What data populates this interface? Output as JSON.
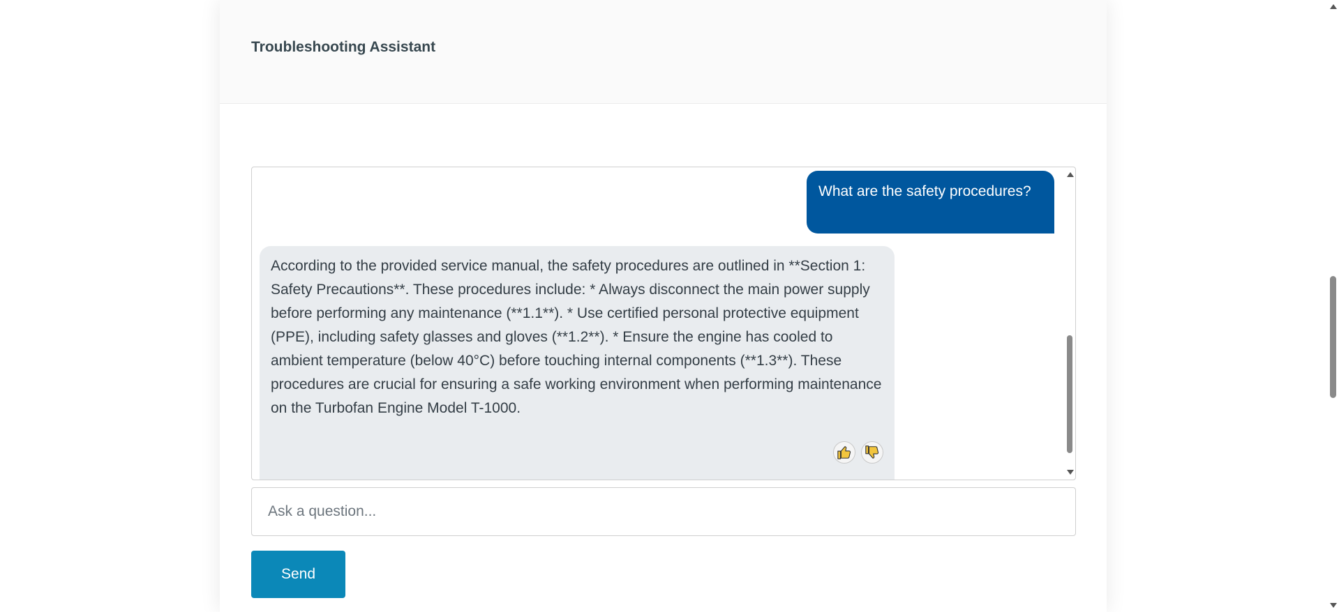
{
  "header": {
    "title": "Troubleshooting Assistant"
  },
  "chat": {
    "messages": [
      {
        "role": "user",
        "text": "What are the safety procedures?"
      },
      {
        "role": "assistant",
        "text": "According to the provided service manual, the safety procedures are outlined in **Section 1: Safety Precautions**. These procedures include: * Always disconnect the main power supply before performing any maintenance (**1.1**). * Use certified personal protective equipment (PPE), including safety glasses and gloves (**1.2**). * Ensure the engine has cooled to ambient temperature (below 40°C) before touching internal components (**1.3**). These procedures are crucial for ensuring a safe working environment when performing maintenance on the Turbofan Engine Model T-1000.",
        "feedback": {
          "up_icon": "thumbs-up-icon",
          "down_icon": "thumbs-down-icon"
        }
      }
    ]
  },
  "input": {
    "placeholder": "Ask a question...",
    "value": ""
  },
  "send_button": {
    "label": "Send"
  },
  "colors": {
    "user_bubble": "#00579e",
    "bot_bubble": "#e9ecef",
    "send_button": "#0b88b8",
    "title_text": "#37474f",
    "feedback_icon": "#f2c53d"
  }
}
